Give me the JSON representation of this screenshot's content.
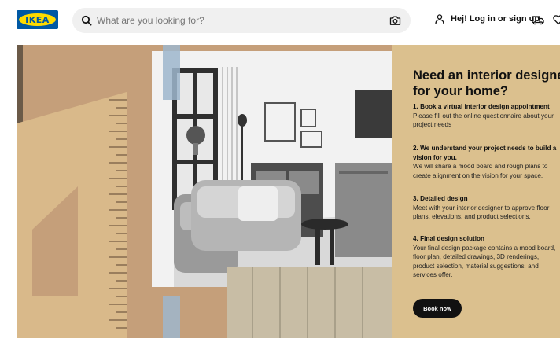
{
  "header": {
    "logo_text": "IKEA",
    "search": {
      "placeholder": "What are you looking for?",
      "value": ""
    },
    "login_label": "Hej! Log in or sign up",
    "icons": [
      "search-icon",
      "camera-icon",
      "user-icon",
      "truck-icon",
      "heart-icon"
    ]
  },
  "hero": {
    "image": "interior design sketch with wooden triangle ruler and fabric swatches",
    "title": "Need an interior designer for your home?",
    "steps": [
      {
        "title": "1. Book a virtual interior design appointment",
        "desc": "Please fill out the online questionnaire about your project needs"
      },
      {
        "title": "2. We understand your project needs to build a vision for you.",
        "desc": "We will share a mood board and rough plans to create alignment on the vision for your space."
      },
      {
        "title": "3. Detailed design",
        "desc": "Meet with your interior designer to approve floor plans, elevations, and product selections."
      },
      {
        "title": "4. Final design solution",
        "desc": "Your final design package contains a mood board, floor plan, detailed drawings, 3D renderings, product selection, material suggestions, and services offer."
      }
    ],
    "cta_label": "Book now"
  },
  "colors": {
    "brand_blue": "#0058a3",
    "brand_yellow": "#ffdb00",
    "panel_bg": "#dbc08e",
    "button_bg": "#111111"
  }
}
